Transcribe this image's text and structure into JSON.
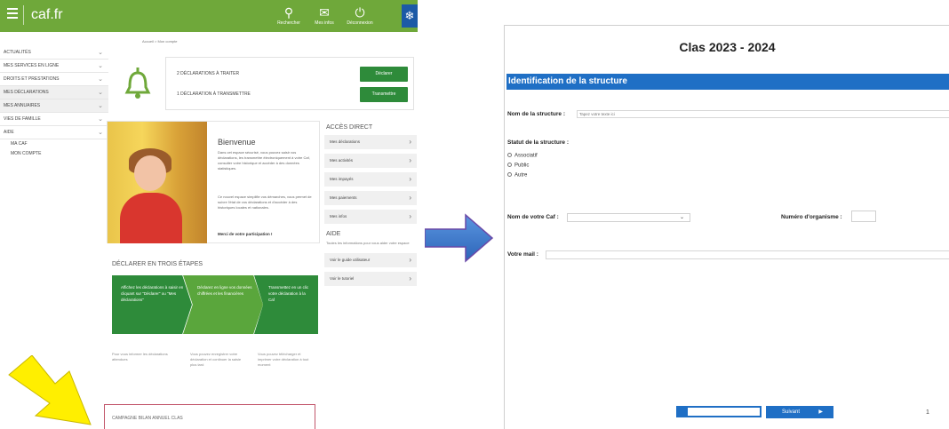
{
  "left_panel": {
    "logo": "caf.fr",
    "topbar_icons": [
      {
        "name": "search-icon",
        "glyph": "⚲",
        "label": "Rechercher"
      },
      {
        "name": "box-icon",
        "glyph": "✉",
        "label": "Mes infos"
      },
      {
        "name": "power-icon",
        "glyph": "⏻",
        "label": "Déconnexion"
      },
      {
        "name": "gear-icon",
        "glyph": "❄"
      }
    ],
    "breadcrumb": "Accueil > Mon compte",
    "menu": [
      {
        "label": "ACTUALITÉS",
        "shaded": false,
        "chev": "⌄"
      },
      {
        "label": "MES SERVICES EN LIGNE",
        "shaded": false,
        "chev": "⌄"
      },
      {
        "label": "DROITS ET PRESTATIONS",
        "shaded": false,
        "chev": "⌄"
      },
      {
        "label": "MES DÉCLARATIONS",
        "shaded": true,
        "chev": "⌄"
      },
      {
        "label": "MES ANNUAIRES",
        "shaded": true,
        "chev": "⌄"
      },
      {
        "label": "VIES DE FAMILLE",
        "shaded": false,
        "chev": "⌄"
      },
      {
        "label": "AIDE",
        "shaded": false,
        "chev": "⌄"
      }
    ],
    "menu_sub": [
      "MA CAF",
      "MON COMPTE"
    ],
    "declarations": {
      "row1": "2 DÉCLARATIONS À TRAITER",
      "row2": "1 DÉCLARATION À TRANSMETTRE",
      "btn1": "Déclarer",
      "btn2": "Transmettre"
    },
    "welcome": {
      "title": "Bienvenue",
      "p1": "Dans cet espace sécurisé, vous pouvez saisir vos déclarations, les transmettre électroniquement à votre Caf, consulter votre historique et accéder à des données statistiques.",
      "p2": "Ce nouvel espace simplifie vos démarches, vous permet de suivre l'état de vos déclarations et d'accéder à des historiques locales et nationales.",
      "link": "Merci de votre participation !"
    },
    "acces_direct": {
      "title": "ACCÈS DIRECT",
      "items": [
        "Mes déclarations",
        "Mes activités",
        "Mes impayés",
        "Mes paiements",
        "Mes infos"
      ],
      "aide_title": "AIDE",
      "aide_text": "Toutes les informations pour vous aider votre espace",
      "aide_items": [
        "Voir le guide utilisateur",
        "Voir le tutoriel"
      ]
    },
    "steps": {
      "title": "DÉCLARER EN TROIS ÉTAPES",
      "items": [
        "Affichez les déclarations à saisir en cliquant sur \"Déclarer\" ou \"Mes déclarations\"",
        "Déclarez en ligne vos données chiffrées et les financières",
        "Transmettez en un clic votre déclaration à la Caf"
      ],
      "descs": [
        "Pour vous informer les déclarations attendues",
        "Vous pouvez enregistrer votre déclaration et continuer la saisie plus tard",
        "Vous pouvez télécharger et imprimer votre déclaration à tout moment"
      ]
    },
    "campaign": "CAMPAGNE BILAN ANNUEL CLAS"
  },
  "form": {
    "title": "Clas 2023 - 2024",
    "section": "Identification de la structure",
    "nom_label": "Nom de la structure :",
    "nom_placeholder": "Tapez votre texte ici",
    "statut_label": "Statut de la structure :",
    "statut_options": [
      "Associatif",
      "Public",
      "Autre"
    ],
    "caf_label": "Nom de votre Caf :",
    "caf_value": "",
    "org_label": "Numéro d'organisme :",
    "mail_label": "Votre mail :",
    "next_label": "Suivant",
    "next_arrow": "▶",
    "progress": 0.12,
    "page": "1"
  },
  "colors": {
    "caf_green": "#6fa83a",
    "button_green": "#2e8b3a",
    "form_blue": "#1f6fc5",
    "arrow_yellow": "#ffef00",
    "arrow_blue": "#3b7bd2"
  }
}
